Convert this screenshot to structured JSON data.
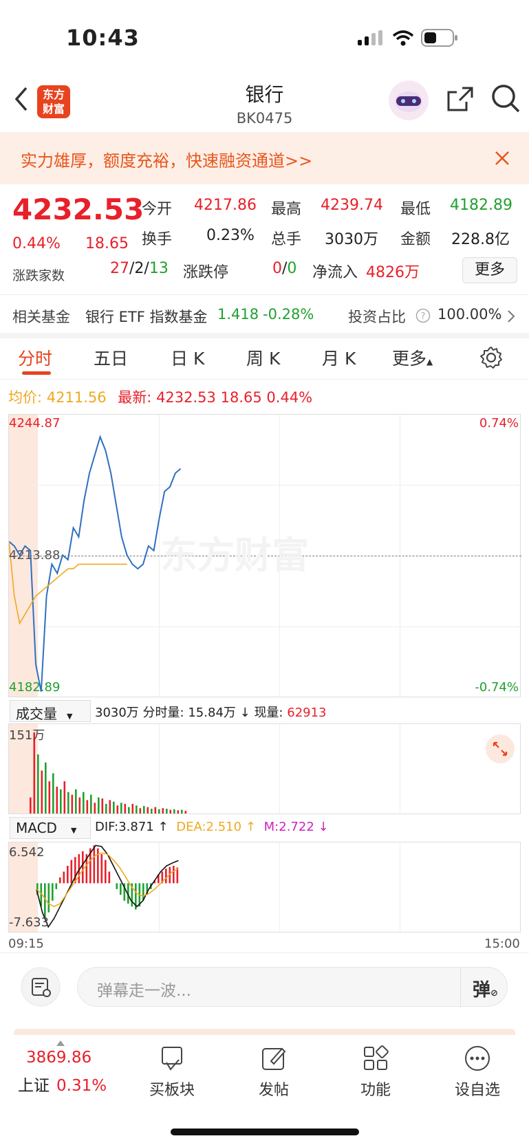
{
  "status_bar": {
    "time": "10:43"
  },
  "nav": {
    "title": "银行",
    "code": "BK0475",
    "logo_text_1": "东方",
    "logo_text_2": "财富"
  },
  "banner": {
    "text": "实力雄厚，额度充裕，快速融资通道>>"
  },
  "quote": {
    "price": "4232.53",
    "change_pct": "0.44%",
    "change": "18.65",
    "open_label": "今开",
    "open": "4217.86",
    "high_label": "最高",
    "high": "4239.74",
    "low_label": "最低",
    "low": "4182.89",
    "turnover_label": "换手",
    "turnover": "0.23%",
    "volume_label": "总手",
    "volume": "3030万",
    "amount_label": "金额",
    "amount": "228.8亿",
    "breadth_label": "涨跌家数",
    "up_count": "27",
    "flat_count": "2",
    "down_count": "13",
    "limit_label": "涨跌停",
    "limit_up": "0",
    "limit_down": "0",
    "inflow_label": "净流入",
    "inflow": "4826万",
    "more_label": "更多"
  },
  "fund": {
    "label": "相关基金",
    "name": "银行 ETF 指数基金",
    "price": "1.418",
    "change": "-0.28%",
    "ratio_label": "投资占比",
    "ratio": "100.00%"
  },
  "tabs": [
    "分时",
    "五日",
    "日 K",
    "周 K",
    "月 K",
    "更多"
  ],
  "price_header": {
    "avg_label": "均价:",
    "avg": "4211.56",
    "latest_label": "最新:",
    "latest": "4232.53",
    "change": "18.65",
    "pct": "0.44%"
  },
  "volume_header": {
    "selector": "成交量",
    "total": "3030万",
    "per_min_label": "分时量:",
    "per_min": "15.84万 ↓",
    "now_label": "现量:",
    "now": "62913"
  },
  "macd_header": {
    "selector": "MACD",
    "dif": "DIF:3.871 ↑",
    "dea": "DEA:2.510 ↑",
    "m": "M:2.722 ↓"
  },
  "time_axis": {
    "start": "09:15",
    "end": "15:00"
  },
  "barrage": {
    "placeholder": "弹幕走一波..."
  },
  "bottom_bar": {
    "index_value": "3869.86",
    "index_name": "上证",
    "index_pct": "0.31%",
    "items": [
      "买板块",
      "发帖",
      "功能",
      "设自选"
    ]
  },
  "colors": {
    "up": "#e8202a",
    "down": "#1fa12f",
    "accent": "#e8431f",
    "price_line": "#2f6fbf",
    "avg_line": "#f0a820"
  },
  "chart_data": [
    {
      "type": "line",
      "title": "",
      "ylim": [
        4182.89,
        4244.87
      ],
      "y_ticks": [
        "4244.87",
        "4213.88",
        "4182.89"
      ],
      "right_ticks": [
        "0.74%",
        "-0.74%"
      ],
      "series": [
        {
          "values": [
            4217,
            4216,
            4214,
            4216,
            4215,
            4190,
            4184,
            4205,
            4212,
            4210,
            4214,
            4213,
            4220,
            4218,
            4226,
            4232,
            4236,
            4240,
            4237,
            4232,
            4225,
            4218,
            4214,
            4212,
            4211,
            4212,
            4216,
            4215,
            4222,
            4228,
            4229,
            4232,
            4233
          ]
        },
        {
          "values": [
            4217,
            4205,
            4199,
            4201,
            4203,
            4205,
            4206,
            4207,
            4208,
            4209,
            4210,
            4211,
            4211,
            4212,
            4212,
            4212,
            4212,
            4212,
            4212,
            4212,
            4212,
            4212,
            4212
          ]
        }
      ]
    },
    {
      "type": "bar",
      "title": "",
      "y_ticks": [
        "151万"
      ],
      "values": [
        30,
        151,
        110,
        80,
        95,
        60,
        75,
        50,
        45,
        60,
        40,
        35,
        45,
        30,
        40,
        25,
        35,
        20,
        30,
        28,
        18,
        25,
        22,
        15,
        20,
        18,
        12,
        18,
        15,
        10,
        14,
        12,
        9,
        12,
        8,
        10,
        9,
        7,
        8,
        6,
        7,
        5
      ],
      "up_down": [
        1,
        1,
        0,
        1,
        0,
        1,
        0,
        1,
        0,
        1,
        0,
        1,
        0,
        1,
        0,
        1,
        0,
        1,
        0,
        1,
        0,
        1,
        0,
        1,
        0,
        1,
        0,
        1,
        0,
        1,
        0,
        1,
        0,
        1,
        0,
        1,
        0,
        1,
        0,
        1,
        0,
        1
      ]
    },
    {
      "type": "bar",
      "title": "",
      "y_ticks": [
        "6.542",
        "-7.633"
      ],
      "values": [
        -2,
        -4,
        -6,
        -5,
        -3,
        -1,
        1,
        2,
        3,
        4,
        4.5,
        5,
        5.5,
        5,
        6,
        6.5,
        6,
        5,
        4,
        2,
        0,
        -1,
        -2,
        -3,
        -3.5,
        -4,
        -4.5,
        -4,
        -3,
        -2,
        -1,
        0.5,
        1.5,
        2,
        2.5,
        2.8,
        3,
        2.7
      ],
      "dif": [
        -1,
        -5,
        -7.5,
        -6,
        -4,
        -2,
        0,
        2,
        3.5,
        5,
        6.5,
        6.3,
        5,
        3,
        1,
        -1,
        -3,
        -4,
        -3,
        -1,
        0.5,
        2,
        3,
        3.5,
        3.9
      ],
      "dea": [
        -1,
        -2,
        -3.5,
        -4,
        -3.5,
        -2,
        -0.5,
        1,
        2.5,
        3.8,
        4.8,
        5.2,
        5,
        4,
        2.8,
        1.2,
        -0.5,
        -1.8,
        -2.2,
        -1.8,
        -1,
        0,
        1,
        2,
        2.5
      ]
    }
  ]
}
